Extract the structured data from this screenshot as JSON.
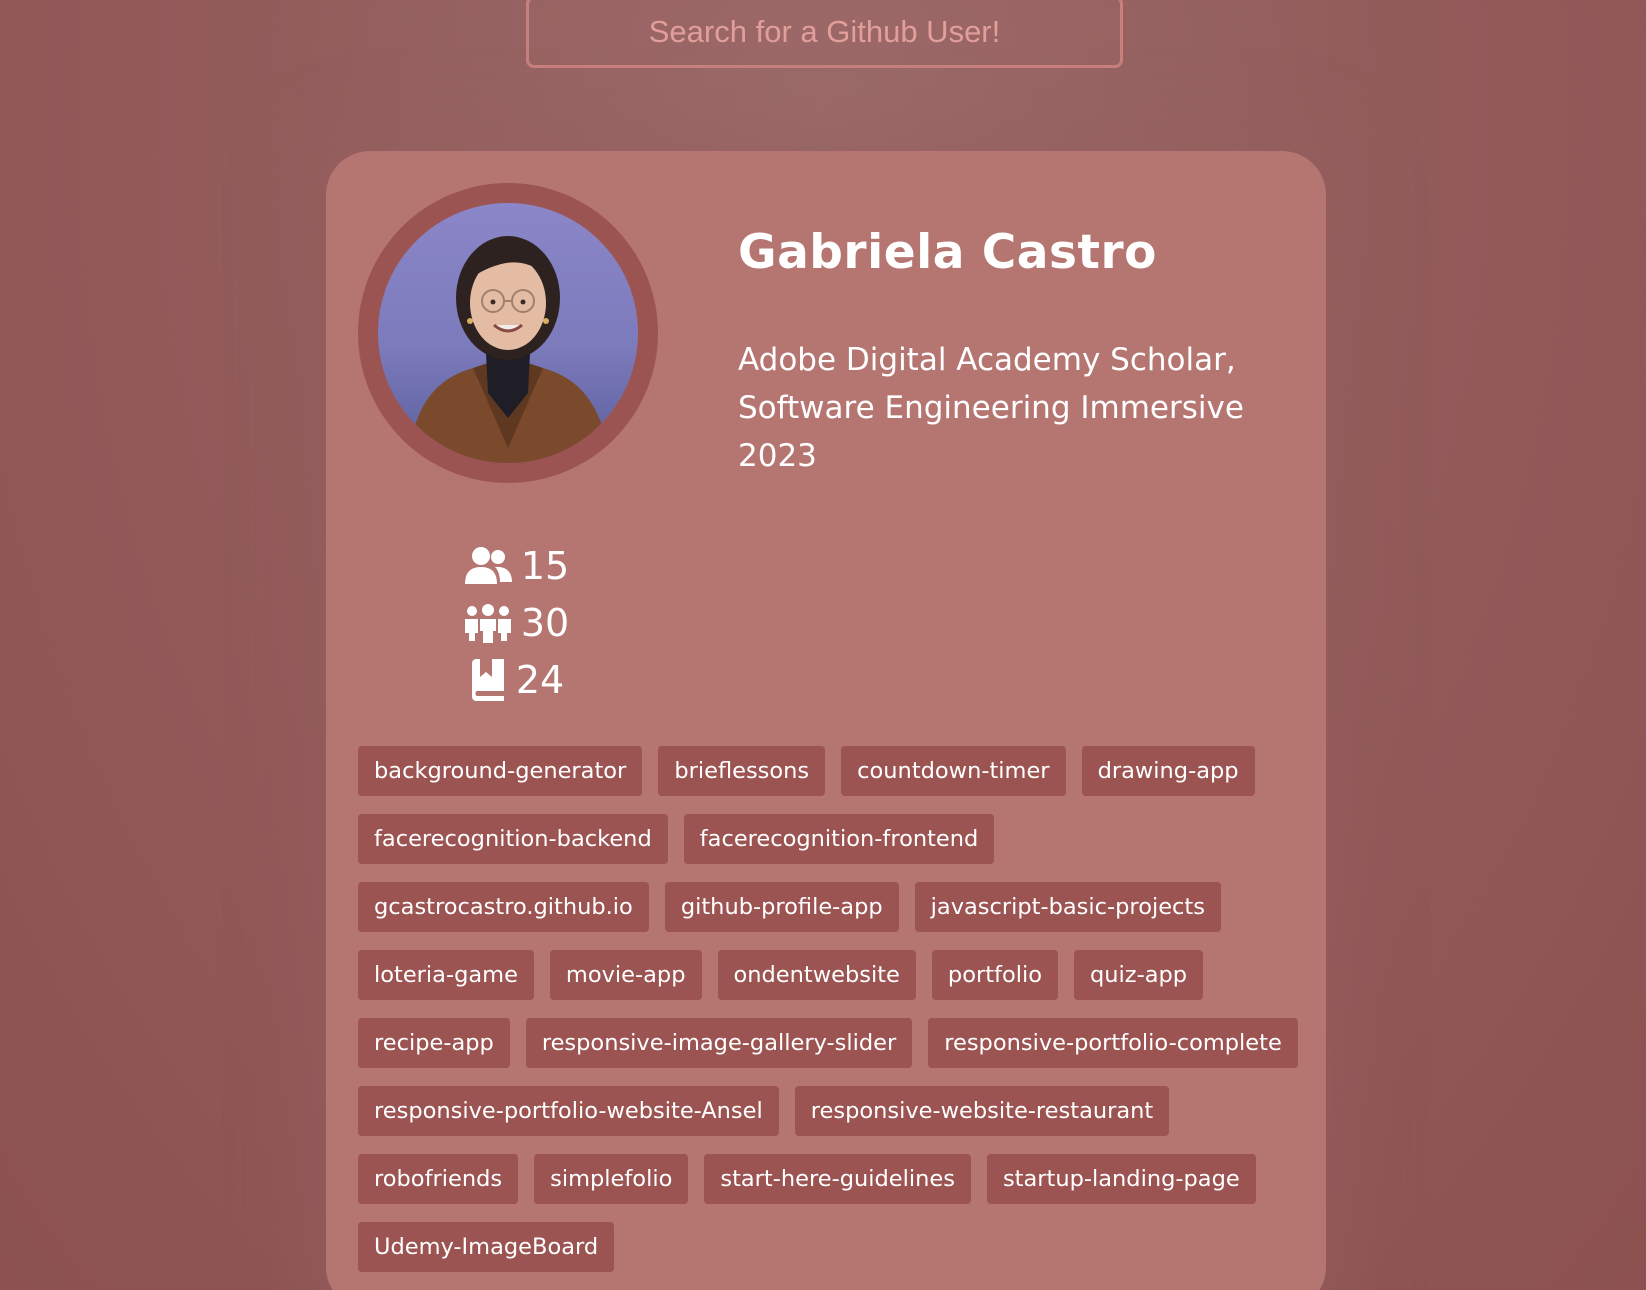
{
  "search": {
    "placeholder": "Search for a Github User!",
    "value": ""
  },
  "profile": {
    "name": "Gabriela Castro",
    "bio": "Adobe Digital Academy Scholar, Software Engineering Immersive 2023",
    "avatar_alt": "avatar"
  },
  "stats": {
    "followers": "15",
    "following": "30",
    "repos": "24"
  },
  "icons": {
    "followers": "user-group-icon",
    "following": "people-group-icon",
    "repos": "book-bookmark-icon"
  },
  "repos": [
    "background-generator",
    "brieflessons",
    "countdown-timer",
    "drawing-app",
    "facerecognition-backend",
    "facerecognition-frontend",
    "gcastrocastro.github.io",
    "github-profile-app",
    "javascript-basic-projects",
    "loteria-game",
    "movie-app",
    "ondentwebsite",
    "portfolio",
    "quiz-app",
    "recipe-app",
    "responsive-image-gallery-slider",
    "responsive-portfolio-complete",
    "responsive-portfolio-website-Ansel",
    "responsive-website-restaurant",
    "robofriends",
    "simplefolio",
    "start-here-guidelines",
    "startup-landing-page",
    "Udemy-ImageBoard"
  ],
  "colors": {
    "background": "#935d5c",
    "card": "#b57571",
    "accent": "#9c5453",
    "text": "#ffffff",
    "search_text": "#e29e9a"
  }
}
